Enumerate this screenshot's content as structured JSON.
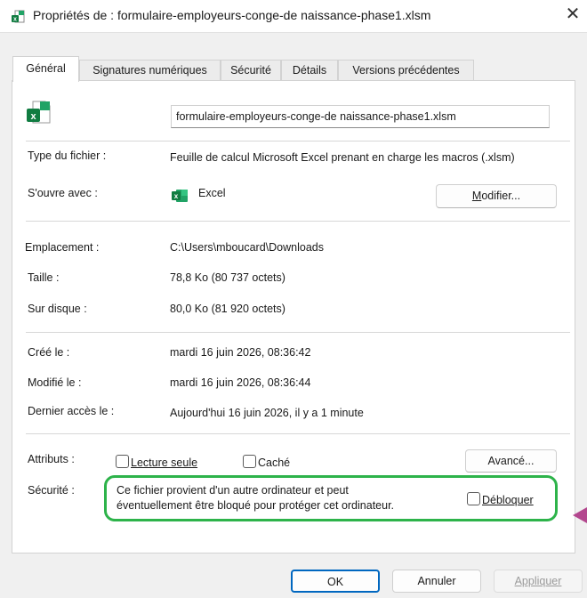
{
  "window": {
    "title": "Propriétés de : formulaire-employeurs-conge-de naissance-phase1.xlsm",
    "close_glyph": "✕"
  },
  "tabs": [
    {
      "label": "Général",
      "active": true
    },
    {
      "label": "Signatures numériques",
      "active": false
    },
    {
      "label": "Sécurité",
      "active": false
    },
    {
      "label": "Détails",
      "active": false
    },
    {
      "label": "Versions précédentes",
      "active": false
    }
  ],
  "general": {
    "filename": "formulaire-employeurs-conge-de naissance-phase1.xlsm",
    "file_icon": "excel-macro-file-icon",
    "type_label": "Type du fichier :",
    "type_value": "Feuille de calcul Microsoft Excel prenant en charge les macros (.xlsm)",
    "opens_with_label": "S'ouvre avec :",
    "opens_with_app": "Excel",
    "app_icon": "excel-icon",
    "change_button": "Modifier...",
    "location_label": "Emplacement :",
    "location_value": "C:\\Users\\mboucard\\Downloads",
    "size_label": "Taille :",
    "size_value": "78,8 Ko (80 737 octets)",
    "disk_label": "Sur disque :",
    "disk_value": "80,0 Ko (81 920 octets)",
    "created_label": "Créé le :",
    "created_value": "mardi 16 juin 2026, 08:36:42",
    "modified_label": "Modifié le :",
    "modified_value": "mardi 16 juin 2026, 08:36:44",
    "accessed_label": "Dernier accès le :",
    "accessed_value": "Aujourd'hui 16 juin 2026, il y a 1 minute",
    "attributes_label": "Attributs :",
    "readonly_label": "Lecture seule",
    "readonly_checked": false,
    "hidden_label": "Caché",
    "hidden_checked": false,
    "advanced_button": "Avancé...",
    "security_label": "Sécurité :",
    "security_line1": "Ce fichier provient d'un autre ordinateur et peut",
    "security_line2": "éventuellement être bloqué pour protéger cet ordinateur.",
    "unblock_label": "Débloquer",
    "unblock_checked": false
  },
  "footer": {
    "ok": "OK",
    "cancel": "Annuler",
    "apply": "Appliquer"
  },
  "colors": {
    "highlight_box": "#2db34a",
    "arrow": "#b3478e",
    "ok_border": "#0067c0",
    "excel_green": "#107c41"
  }
}
